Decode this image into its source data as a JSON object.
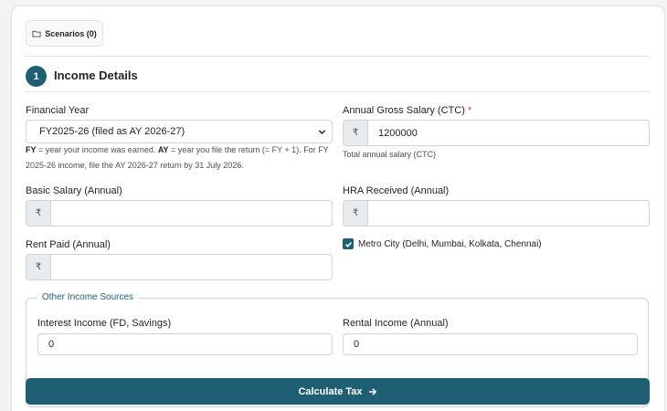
{
  "scenarios_button": {
    "label": "Scenarios (0)"
  },
  "section": {
    "step": "1",
    "title": "Income Details"
  },
  "financial_year": {
    "label": "Financial Year",
    "selected": "FY2025-26 (filed as AY 2026-27)",
    "help": {
      "fy_term": "FY",
      "fy_def": " = year your income was earned. ",
      "ay_term": "AY",
      "ay_def": " = year you file the return (= FY + 1). For FY",
      "line2": "2025-26 income, file the AY 2026-27 return by 31 July 2026."
    }
  },
  "gross_salary": {
    "label": "Annual Gross Salary (CTC)",
    "required_mark": "*",
    "currency": "₹",
    "value": "1200000",
    "help": "Total annual salary (CTC)"
  },
  "basic_salary": {
    "label": "Basic Salary (Annual)",
    "currency": "₹",
    "value": ""
  },
  "hra_received": {
    "label": "HRA Received (Annual)",
    "currency": "₹",
    "value": ""
  },
  "rent_paid": {
    "label": "Rent Paid (Annual)",
    "currency": "₹",
    "value": ""
  },
  "metro_city": {
    "label": "Metro City (Delhi, Mumbai, Kolkata, Chennai)",
    "checked": true
  },
  "other_income": {
    "legend": "Other Income Sources",
    "interest": {
      "label": "Interest Income (FD, Savings)",
      "value": "0"
    },
    "rental": {
      "label": "Rental Income (Annual)",
      "value": "0"
    }
  },
  "calculate_button": {
    "label": "Calculate Tax"
  },
  "colors": {
    "primary": "#1f5f73",
    "required": "#dc3545",
    "addon_bg": "#e9ecef"
  }
}
